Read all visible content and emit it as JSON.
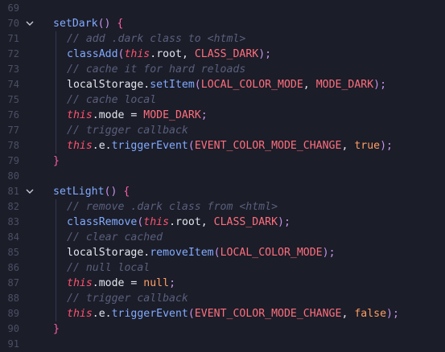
{
  "editor": {
    "language": "javascript",
    "lines": [
      {
        "n": "69",
        "fold": false,
        "indent": 0,
        "tokens": []
      },
      {
        "n": "70",
        "fold": true,
        "indent": 0,
        "tokens": [
          {
            "t": "setDark",
            "c": "fn"
          },
          {
            "t": "()",
            "c": "paren"
          },
          {
            "t": " ",
            "c": "def"
          },
          {
            "t": "{",
            "c": "brace"
          }
        ]
      },
      {
        "n": "71",
        "fold": false,
        "indent": 1,
        "tokens": [
          {
            "t": "// add .dark class to <html>",
            "c": "comment"
          }
        ]
      },
      {
        "n": "72",
        "fold": false,
        "indent": 1,
        "tokens": [
          {
            "t": "classAdd",
            "c": "call"
          },
          {
            "t": "(",
            "c": "paren"
          },
          {
            "t": "this",
            "c": "this"
          },
          {
            "t": ".root, ",
            "c": "id"
          },
          {
            "t": "CLASS_DARK",
            "c": "const"
          },
          {
            "t": ");",
            "c": "paren"
          }
        ]
      },
      {
        "n": "73",
        "fold": false,
        "indent": 1,
        "tokens": [
          {
            "t": "// cache it for hard reloads",
            "c": "comment"
          }
        ]
      },
      {
        "n": "74",
        "fold": false,
        "indent": 1,
        "tokens": [
          {
            "t": "localStorage.",
            "c": "id"
          },
          {
            "t": "setItem",
            "c": "call"
          },
          {
            "t": "(",
            "c": "paren"
          },
          {
            "t": "LOCAL_COLOR_MODE",
            "c": "const"
          },
          {
            "t": ", ",
            "c": "id"
          },
          {
            "t": "MODE_DARK",
            "c": "const"
          },
          {
            "t": ");",
            "c": "paren"
          }
        ]
      },
      {
        "n": "75",
        "fold": false,
        "indent": 1,
        "tokens": [
          {
            "t": "// cache local",
            "c": "comment"
          }
        ]
      },
      {
        "n": "76",
        "fold": false,
        "indent": 1,
        "tokens": [
          {
            "t": "this",
            "c": "this"
          },
          {
            "t": ".mode = ",
            "c": "id"
          },
          {
            "t": "MODE_DARK",
            "c": "const"
          },
          {
            "t": ";",
            "c": "paren"
          }
        ]
      },
      {
        "n": "77",
        "fold": false,
        "indent": 1,
        "tokens": [
          {
            "t": "// trigger callback",
            "c": "comment"
          }
        ]
      },
      {
        "n": "78",
        "fold": false,
        "indent": 1,
        "tokens": [
          {
            "t": "this",
            "c": "this"
          },
          {
            "t": ".e.",
            "c": "id"
          },
          {
            "t": "triggerEvent",
            "c": "call"
          },
          {
            "t": "(",
            "c": "paren"
          },
          {
            "t": "EVENT_COLOR_MODE_CHANGE",
            "c": "const"
          },
          {
            "t": ", ",
            "c": "id"
          },
          {
            "t": "true",
            "c": "kw"
          },
          {
            "t": ");",
            "c": "paren"
          }
        ]
      },
      {
        "n": "79",
        "fold": false,
        "indent": 0,
        "tokens": [
          {
            "t": "}",
            "c": "brace"
          }
        ]
      },
      {
        "n": "80",
        "fold": false,
        "indent": 0,
        "tokens": []
      },
      {
        "n": "81",
        "fold": true,
        "indent": 0,
        "tokens": [
          {
            "t": "setLight",
            "c": "fn"
          },
          {
            "t": "()",
            "c": "paren"
          },
          {
            "t": " ",
            "c": "def"
          },
          {
            "t": "{",
            "c": "brace"
          }
        ]
      },
      {
        "n": "82",
        "fold": false,
        "indent": 1,
        "tokens": [
          {
            "t": "// remove .dark class from <html>",
            "c": "comment"
          }
        ]
      },
      {
        "n": "83",
        "fold": false,
        "indent": 1,
        "tokens": [
          {
            "t": "classRemove",
            "c": "call"
          },
          {
            "t": "(",
            "c": "paren"
          },
          {
            "t": "this",
            "c": "this"
          },
          {
            "t": ".root, ",
            "c": "id"
          },
          {
            "t": "CLASS_DARK",
            "c": "const"
          },
          {
            "t": ");",
            "c": "paren"
          }
        ]
      },
      {
        "n": "84",
        "fold": false,
        "indent": 1,
        "tokens": [
          {
            "t": "// clear cached",
            "c": "comment"
          }
        ]
      },
      {
        "n": "85",
        "fold": false,
        "indent": 1,
        "tokens": [
          {
            "t": "localStorage.",
            "c": "id"
          },
          {
            "t": "removeItem",
            "c": "call"
          },
          {
            "t": "(",
            "c": "paren"
          },
          {
            "t": "LOCAL_COLOR_MODE",
            "c": "const"
          },
          {
            "t": ");",
            "c": "paren"
          }
        ]
      },
      {
        "n": "86",
        "fold": false,
        "indent": 1,
        "tokens": [
          {
            "t": "// null local",
            "c": "comment"
          }
        ]
      },
      {
        "n": "87",
        "fold": false,
        "indent": 1,
        "tokens": [
          {
            "t": "this",
            "c": "this"
          },
          {
            "t": ".mode = ",
            "c": "id"
          },
          {
            "t": "null",
            "c": "kw"
          },
          {
            "t": ";",
            "c": "paren"
          }
        ]
      },
      {
        "n": "88",
        "fold": false,
        "indent": 1,
        "tokens": [
          {
            "t": "// trigger callback",
            "c": "comment"
          }
        ]
      },
      {
        "n": "89",
        "fold": false,
        "indent": 1,
        "tokens": [
          {
            "t": "this",
            "c": "this"
          },
          {
            "t": ".e.",
            "c": "id"
          },
          {
            "t": "triggerEvent",
            "c": "call"
          },
          {
            "t": "(",
            "c": "paren"
          },
          {
            "t": "EVENT_COLOR_MODE_CHANGE",
            "c": "const"
          },
          {
            "t": ", ",
            "c": "id"
          },
          {
            "t": "false",
            "c": "kw"
          },
          {
            "t": ");",
            "c": "paren"
          }
        ]
      },
      {
        "n": "90",
        "fold": false,
        "indent": 0,
        "tokens": [
          {
            "t": "}",
            "c": "brace"
          }
        ]
      },
      {
        "n": "91",
        "fold": false,
        "indent": 0,
        "tokens": []
      }
    ]
  },
  "colors": {
    "background": "#1b1d28",
    "line_number": "#4b4f66",
    "function_name": "#82aaff",
    "constant": "#ff6e7e",
    "this_keyword": "#ff5370",
    "comment": "#5a5f7d",
    "literal": "#ff9e64",
    "brace": "#ff5ea8"
  },
  "icons": {
    "fold": "chevron-down-icon"
  }
}
